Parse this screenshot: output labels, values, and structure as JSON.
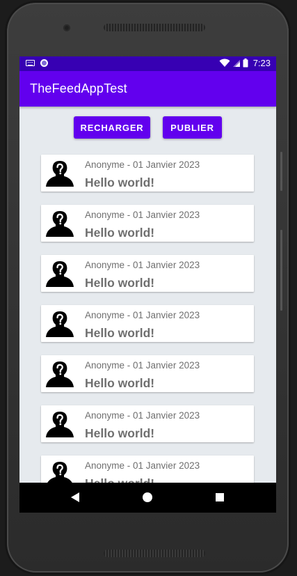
{
  "status_bar": {
    "time": "7:23",
    "left_icons": [
      "keyboard-icon",
      "sync-icon"
    ],
    "right_icons": [
      "wifi-icon",
      "signal-icon",
      "battery-icon"
    ]
  },
  "app_bar": {
    "title": "TheFeedAppTest"
  },
  "actions": {
    "reload_label": "RECHARGER",
    "publish_label": "PUBLIER"
  },
  "feed": {
    "items": [
      {
        "meta": "Anonyme - 01 Janvier 2023",
        "message": "Hello world!"
      },
      {
        "meta": "Anonyme - 01 Janvier 2023",
        "message": "Hello world!"
      },
      {
        "meta": "Anonyme - 01 Janvier 2023",
        "message": "Hello world!"
      },
      {
        "meta": "Anonyme - 01 Janvier 2023",
        "message": "Hello world!"
      },
      {
        "meta": "Anonyme - 01 Janvier 2023",
        "message": "Hello world!"
      },
      {
        "meta": "Anonyme - 01 Janvier 2023",
        "message": "Hello world!"
      },
      {
        "meta": "Anonyme - 01 Janvier 2023",
        "message": "Hello world!"
      }
    ]
  },
  "nav_bar": {
    "icons": [
      "back-icon",
      "home-icon",
      "recents-icon"
    ]
  },
  "colors": {
    "primary": "#6200ee",
    "primary_dark": "#3700b3",
    "background": "#e6eaee",
    "text_secondary": "#6f6f6f"
  }
}
